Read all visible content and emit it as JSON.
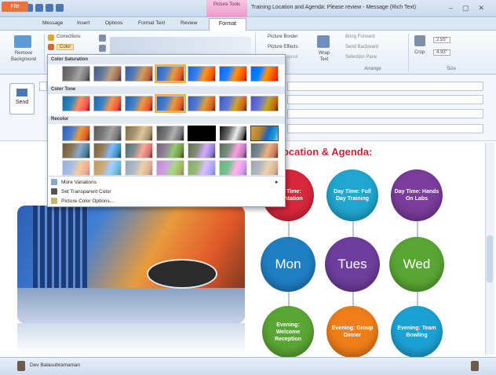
{
  "window": {
    "title": "Training Location and Agenda: Please review - Message (Rich Text)",
    "context_tab": "Picture Tools"
  },
  "tabs": [
    "File",
    "Message",
    "Insert",
    "Options",
    "Format Text",
    "Review",
    "Format"
  ],
  "ribbon": {
    "remove_bg": "Remove Background",
    "corrections": "Corrections",
    "color": "Color",
    "border": "Picture Border",
    "effects": "Picture Effects",
    "layout": "Picture Layout",
    "wrap": "Wrap Text",
    "bring": "Bring Forward",
    "send_back": "Send Backward",
    "sel_pane": "Selection Pane",
    "arrange": "Arrange",
    "crop": "Crop",
    "height": "2.55\"",
    "width": "4.93\"",
    "size": "Size"
  },
  "header": {
    "send": "Send"
  },
  "gallery": {
    "sections": [
      "Color Saturation",
      "Color Tone",
      "Recolor"
    ],
    "menu": [
      "More Variations",
      "Set Transparent Color",
      "Picture Color Options..."
    ]
  },
  "agenda": {
    "title": "Location & Agenda:",
    "top": [
      {
        "label": "Day Time: Orientation",
        "color": "#d9273c"
      },
      {
        "label": "Day Time: Full Day Training",
        "color": "#20a6cf"
      },
      {
        "label": "Day Time: Hands On Labs",
        "color": "#7b3c9b"
      }
    ],
    "days": [
      {
        "label": "Mon",
        "color": "#1f7fc3"
      },
      {
        "label": "Tues",
        "color": "#6d3e9c"
      },
      {
        "label": "Wed",
        "color": "#5aa634"
      }
    ],
    "evening": [
      {
        "label": "Evening: Welcome Reception",
        "color": "#5aa634"
      },
      {
        "label": "Evening: Group Dinner",
        "color": "#ef7d1a"
      },
      {
        "label": "Evening: Team Bowling",
        "color": "#1ca1d4"
      }
    ]
  },
  "status": {
    "name": "Dev Balasubramanian"
  }
}
